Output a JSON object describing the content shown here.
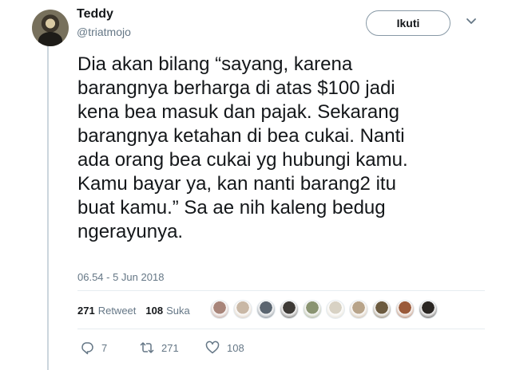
{
  "author": {
    "name": "Teddy",
    "handle": "@triatmojo"
  },
  "follow_label": "Ikuti",
  "tweet": {
    "lines": [
      "Dia akan bilang “sayang, karena",
      "barangnya berharga di atas $100 jadi",
      "kena bea masuk dan pajak. Sekarang",
      "barangnya ketahan di bea cukai. Nanti",
      "ada orang bea cukai yg hubungi kamu.",
      "Kamu bayar ya, kan nanti barang2 itu",
      "buat kamu.” Sa ae nih kaleng bedug",
      "ngerayunya."
    ],
    "timestamp": "06.54 - 5 Jun 2018"
  },
  "stats": {
    "retweet_count": "271",
    "retweet_label": "Retweet",
    "like_count": "108",
    "like_label": "Suka"
  },
  "liker_avatar_colors": [
    "#a8857a",
    "#c9b8a6",
    "#5a6570",
    "#3d3a36",
    "#8a9472",
    "#d8d2c4",
    "#b8a48a",
    "#6b5a3f",
    "#9a5a3a",
    "#2a2623"
  ],
  "actions": {
    "reply_count": "7",
    "retweet_count": "271",
    "like_count": "108"
  },
  "icons": {
    "reply": "reply-icon",
    "retweet": "retweet-icon",
    "like": "heart-icon",
    "caret": "chevron-down-icon"
  },
  "colors": {
    "text": "#14171a",
    "muted": "#657786",
    "border": "#e6ecf0",
    "thread_line": "#ccd6dd"
  }
}
